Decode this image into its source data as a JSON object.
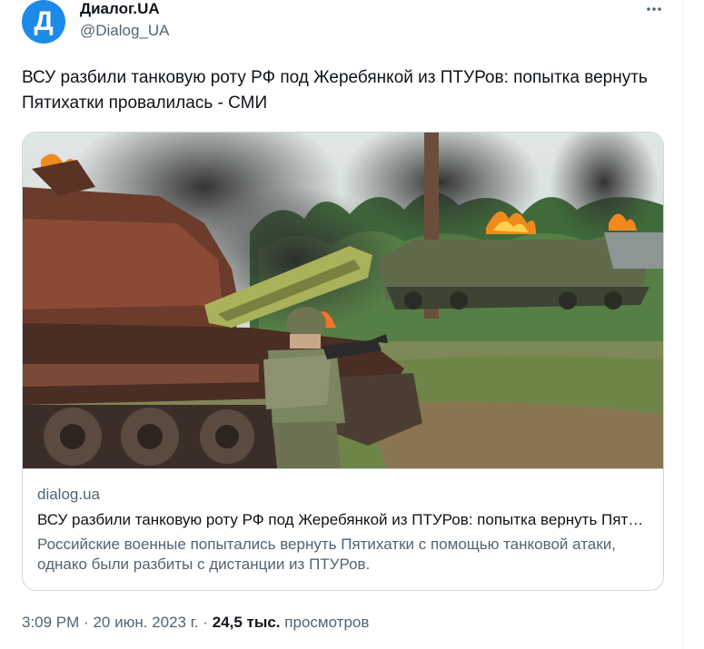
{
  "author": {
    "avatar_letter": "Д",
    "avatar_color": "#1d8ae8",
    "name": "Диалог.UA",
    "handle": "@Dialog_UA"
  },
  "tweet": {
    "text": "ВСУ разбили танковую роту РФ под Жеребянкой из ПТУРов: попытка вернуть Пятихатки провалилась - СМИ"
  },
  "card": {
    "image_icon": "news-photo-image",
    "domain": "dialog.ua",
    "title": "ВСУ разбили танковую роту РФ под Жеребянкой из ПТУРов: попытка вернуть Пятихатки провалилась - СМИ",
    "description": "Российские военные попытались вернуть Пятихатки с помощью танковой атаки, однако были разбиты с дистанции из ПТУРов."
  },
  "meta": {
    "time": "3:09 PM",
    "separator": "·",
    "date": "20 июн. 2023 г.",
    "views_count": "24,5 тыс.",
    "views_label": "просмотров"
  },
  "colors": {
    "text_primary": "#0f1419",
    "text_secondary": "#536471",
    "border": "#cfd9de"
  }
}
